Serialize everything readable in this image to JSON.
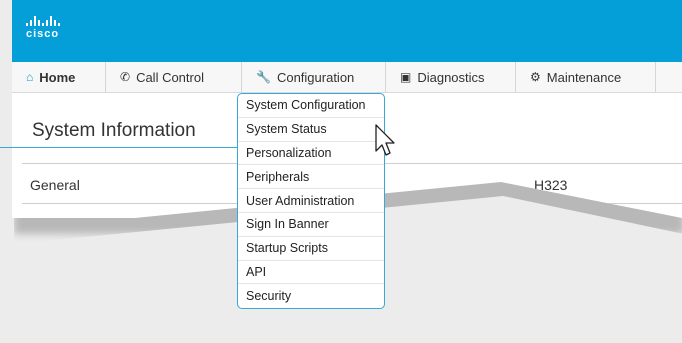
{
  "brand": {
    "logo_text": "cisco",
    "bar_color": "#049fd9"
  },
  "nav": [
    {
      "label": "Home",
      "icon": "home-icon"
    },
    {
      "label": "Call Control",
      "icon": "phone-icon"
    },
    {
      "label": "Configuration",
      "icon": "wrench-icon"
    },
    {
      "label": "Diagnostics",
      "icon": "toolbox-icon"
    },
    {
      "label": "Maintenance",
      "icon": "gear-icon"
    }
  ],
  "main": {
    "title": "System Information",
    "section_label": "General",
    "protocol_label": "H323"
  },
  "dropdown": {
    "items": [
      "System Configuration",
      "System Status",
      "Personalization",
      "Peripherals",
      "User Administration",
      "Sign In Banner",
      "Startup Scripts",
      "API",
      "Security"
    ]
  },
  "colors": {
    "accent": "#3aa8d6"
  }
}
